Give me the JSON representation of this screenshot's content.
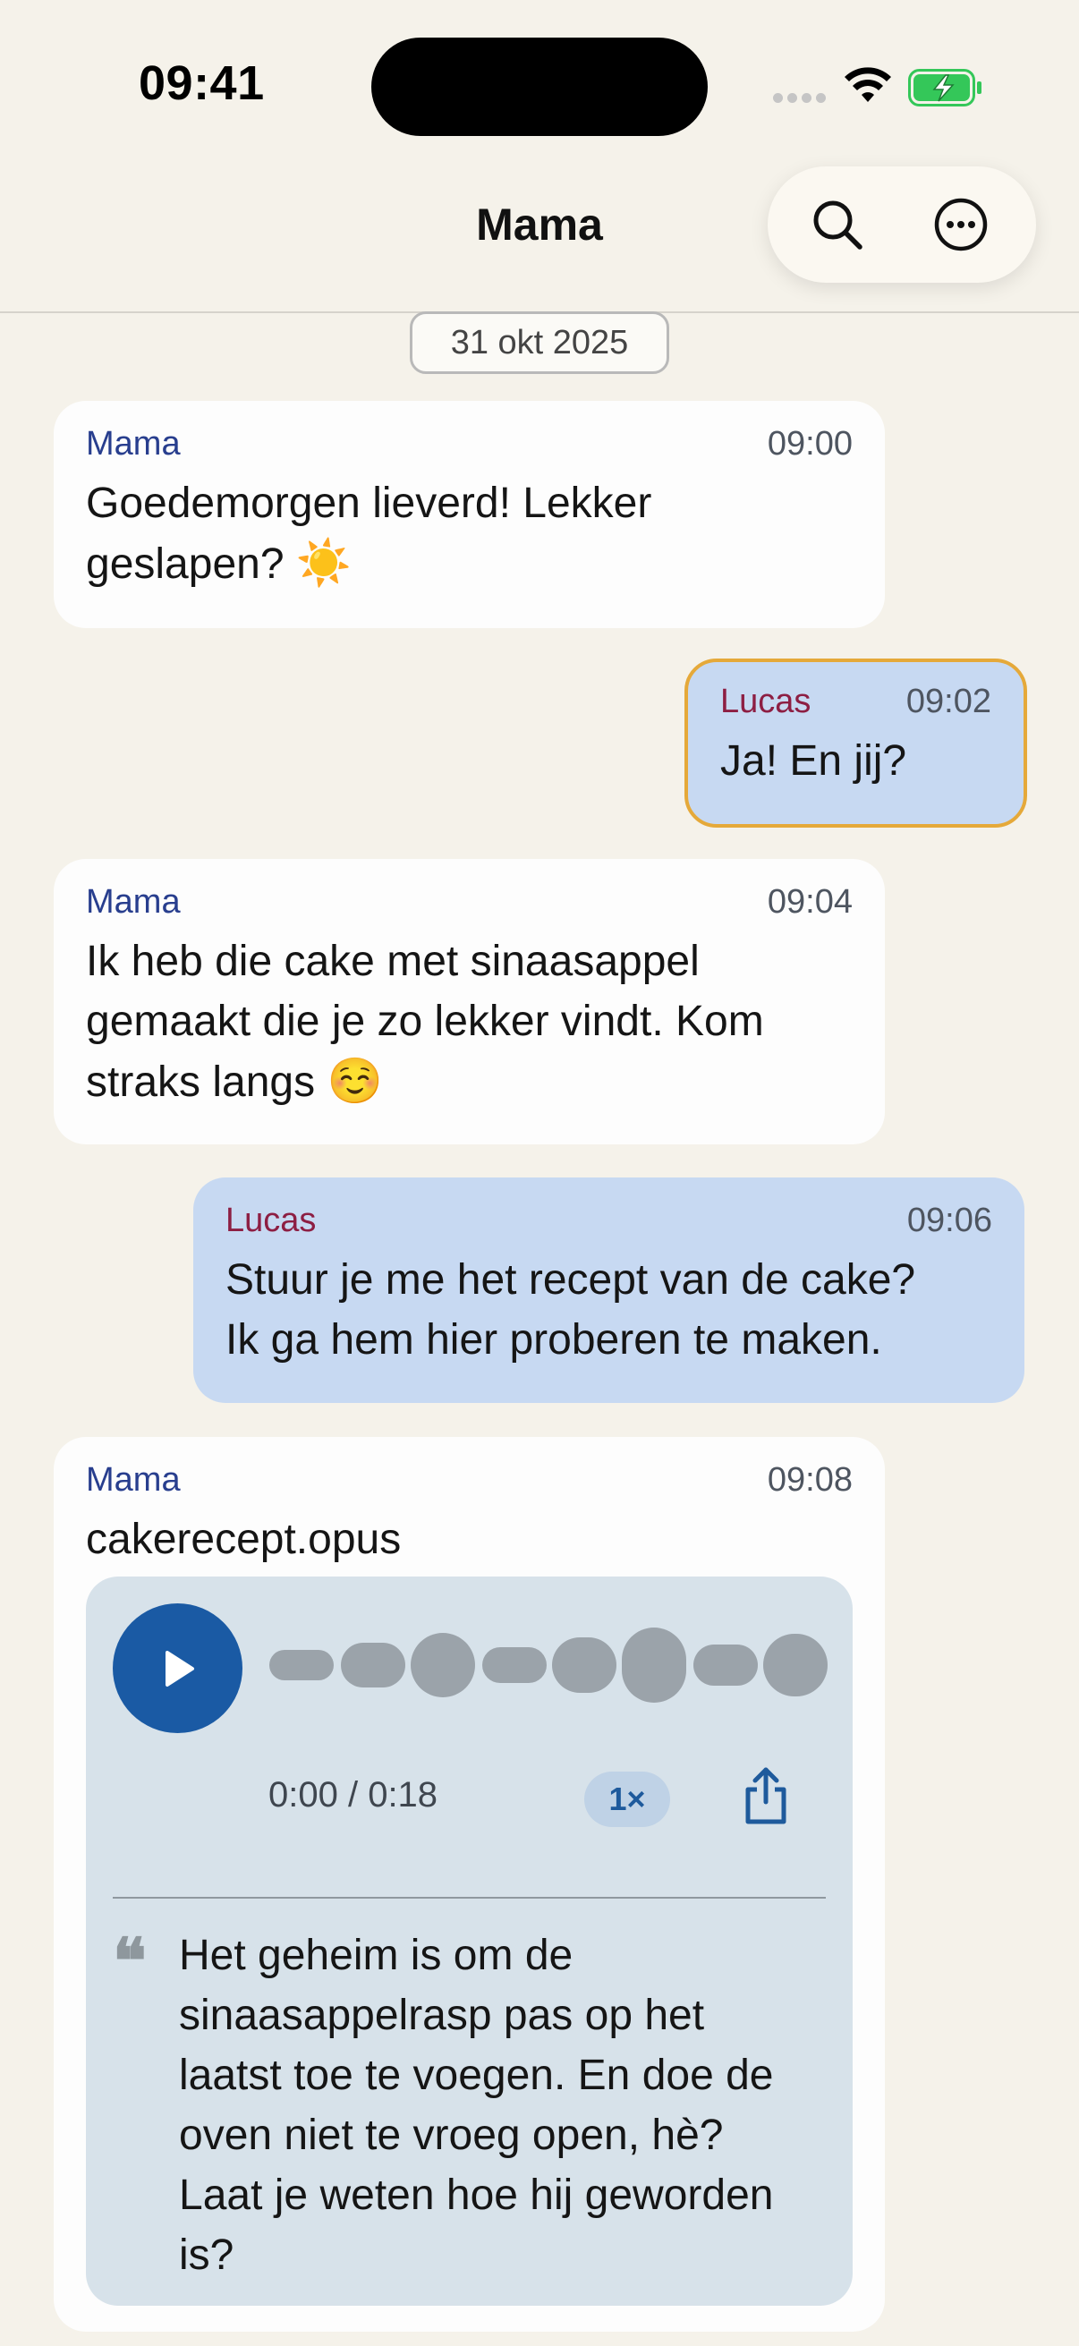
{
  "status_bar": {
    "time": "09:41"
  },
  "header": {
    "title": "Mama",
    "search_icon": "search-icon",
    "more_icon": "ellipsis-circle-icon"
  },
  "date_divider": "31 okt 2025",
  "messages": [
    {
      "sender": "Mama",
      "time": "09:00",
      "lines": [
        "Goedemorgen lieverd! Lekker",
        "geslapen?"
      ],
      "emoji": "☀️",
      "direction": "incoming"
    },
    {
      "sender": "Lucas",
      "time": "09:02",
      "lines": [
        "Ja! En jij?"
      ],
      "direction": "outgoing",
      "highlighted": true
    },
    {
      "sender": "Mama",
      "time": "09:04",
      "lines": [
        "Ik heb die cake met sinaasappel",
        "gemaakt die je zo lekker vindt. Kom",
        "straks langs"
      ],
      "emoji": "☺️",
      "direction": "incoming"
    },
    {
      "sender": "Lucas",
      "time": "09:06",
      "lines": [
        "Stuur je me het recept van de cake?",
        "Ik ga hem hier proberen te maken."
      ],
      "direction": "outgoing"
    },
    {
      "sender": "Mama",
      "time": "09:08",
      "direction": "incoming",
      "attachment": {
        "filename": "cakerecept.opus",
        "duration_text": "0:00 / 0:18",
        "progress": 0,
        "speed": "1×",
        "transcript_lines": [
          "Het geheim is om de",
          "sinaasappelrasp pas op het",
          "laatst toe te voegen. En doe de",
          "oven niet te vroeg open, hè?",
          "Laat je weten hoe hij geworden",
          "is?"
        ]
      }
    }
  ],
  "colors": {
    "background": "#f5f2ea",
    "incoming_bubble": "#fdfdfd",
    "outgoing_bubble": "#c7d9f2",
    "highlight_border": "#e5a93a",
    "mama_name": "#283e8e",
    "lucas_name": "#8d1e43",
    "play_button": "#1a5aa4",
    "audio_card": "#d7e2ea"
  }
}
